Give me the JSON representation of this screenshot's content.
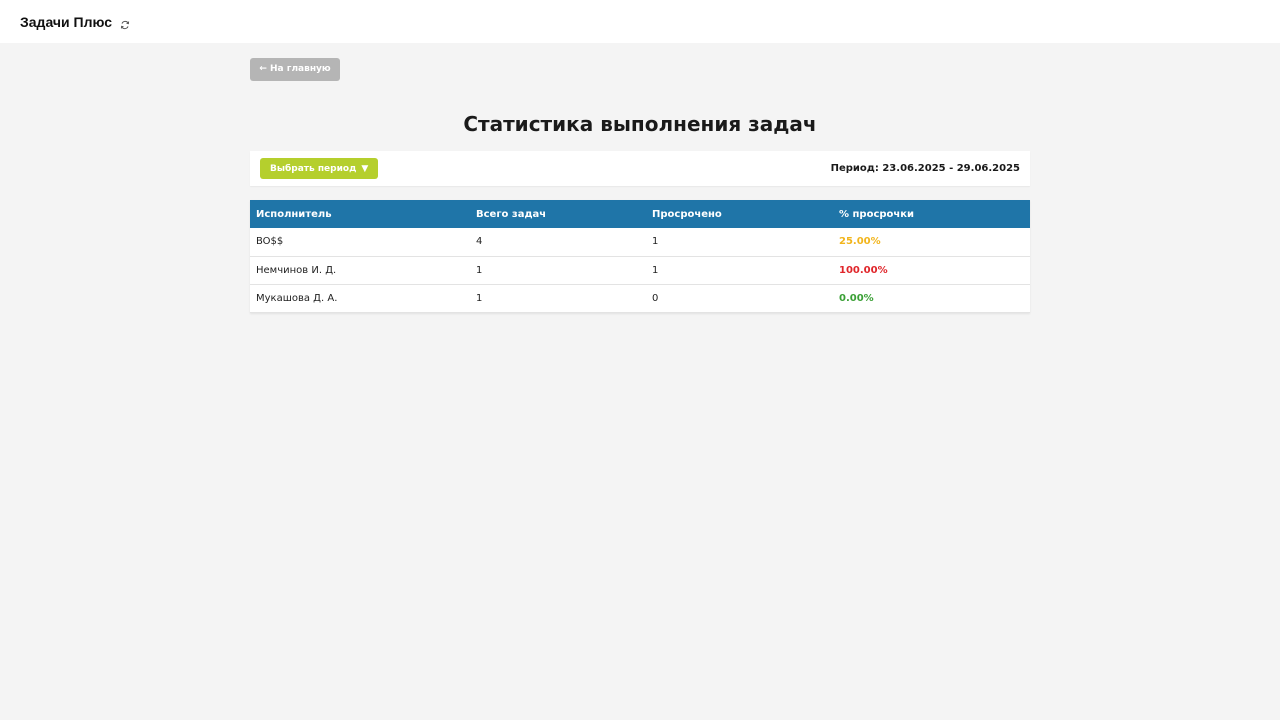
{
  "header": {
    "app_title": "Задачи Плюс",
    "refresh_icon": "refresh-icon"
  },
  "nav": {
    "back_label": "← На главную"
  },
  "page": {
    "title": "Статистика выполнения задач"
  },
  "period": {
    "button_label": "Выбрать период",
    "button_caret": "▼",
    "label": "Период: 23.06.2025 - 29.06.2025"
  },
  "table": {
    "columns": [
      "Исполнитель",
      "Всего задач",
      "Просрочено",
      "% просрочки"
    ],
    "rows": [
      {
        "name": "BO$$",
        "total": "4",
        "overdue": "1",
        "pct": "25.00%",
        "pct_color": "#f2b51c"
      },
      {
        "name": "Немчинов И. Д.",
        "total": "1",
        "overdue": "1",
        "pct": "100.00%",
        "pct_color": "#e0262b"
      },
      {
        "name": "Мукашова Д. А.",
        "total": "1",
        "overdue": "0",
        "pct": "0.00%",
        "pct_color": "#3ba036"
      }
    ]
  },
  "colors": {
    "header_bg": "#1f75a8",
    "period_button": "#b5cf2d",
    "back_button": "#b5b5b5"
  }
}
